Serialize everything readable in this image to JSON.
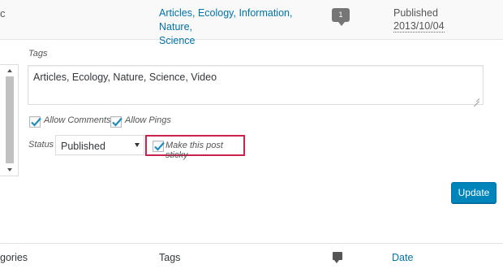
{
  "list_row": {
    "cut_text": "c",
    "categories_parts": [
      "Articles",
      "Ecology",
      "Information",
      "Nature",
      "Science"
    ],
    "comment_count": "1",
    "status": "Published",
    "date": "2013/10/04"
  },
  "quick_edit": {
    "tags_label": "Tags",
    "tags_value": "Articles, Ecology, Nature, Science, Video",
    "allow_comments_label": "Allow Comments",
    "allow_comments_checked": true,
    "allow_pings_label": "Allow Pings",
    "allow_pings_checked": true,
    "status_label": "Status",
    "status_value": "Published",
    "sticky_label": "Make this post sticky",
    "sticky_checked": true,
    "update_button": "Update"
  },
  "footer": {
    "categories_header": "gories",
    "tags_header": "Tags",
    "date_header": "Date"
  },
  "colors": {
    "link": "#0073aa",
    "primary_button": "#0085ba",
    "highlight_border": "#c8224d",
    "check": "#1e8cbe"
  },
  "icons": {
    "comment_bubble": "comment-bubble-icon",
    "comments_column": "comment-icon",
    "checkmark": "checkmark-icon"
  }
}
